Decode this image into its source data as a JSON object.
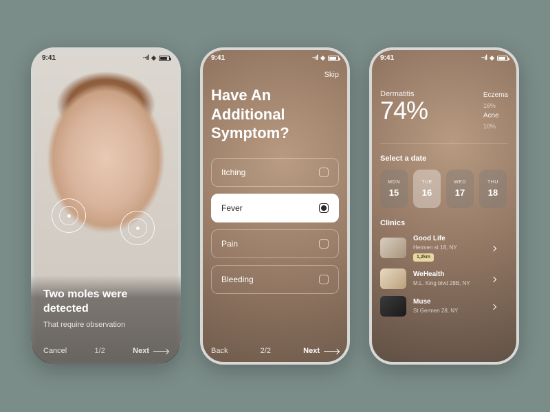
{
  "status": {
    "time": "9:41"
  },
  "screen1": {
    "title": "Two moles were detected",
    "subtitle": "That require observation",
    "cancel": "Cancel",
    "progress": "1/2",
    "next": "Next"
  },
  "screen2": {
    "skip": "Skip",
    "title": "Have An Additional Symptom?",
    "options": [
      {
        "label": "Itching",
        "selected": false
      },
      {
        "label": "Fever",
        "selected": true
      },
      {
        "label": "Pain",
        "selected": false
      },
      {
        "label": "Bleeding",
        "selected": false
      }
    ],
    "back": "Back",
    "progress": "2/2",
    "next": "Next"
  },
  "screen3": {
    "primary": {
      "label": "Dermatitis",
      "pct": "74%"
    },
    "secondary": [
      {
        "label": "Eczema",
        "pct": "16%"
      },
      {
        "label": "Acne",
        "pct": "10%"
      }
    ],
    "date_label": "Select a date",
    "dates": [
      {
        "dow": "MON",
        "num": "15",
        "selected": false
      },
      {
        "dow": "TUE",
        "num": "16",
        "selected": true
      },
      {
        "dow": "WED",
        "num": "17",
        "selected": false
      },
      {
        "dow": "THU",
        "num": "18",
        "selected": false
      }
    ],
    "clinics_label": "Clinics",
    "clinics": [
      {
        "name": "Good Life",
        "address": "Hermen st 18, NY",
        "distance": "1,2km"
      },
      {
        "name": "WeHealth",
        "address": "M.L. King blvd 28B, NY",
        "distance": ""
      },
      {
        "name": "Muse",
        "address": "St Germen 28, NY",
        "distance": ""
      }
    ]
  }
}
